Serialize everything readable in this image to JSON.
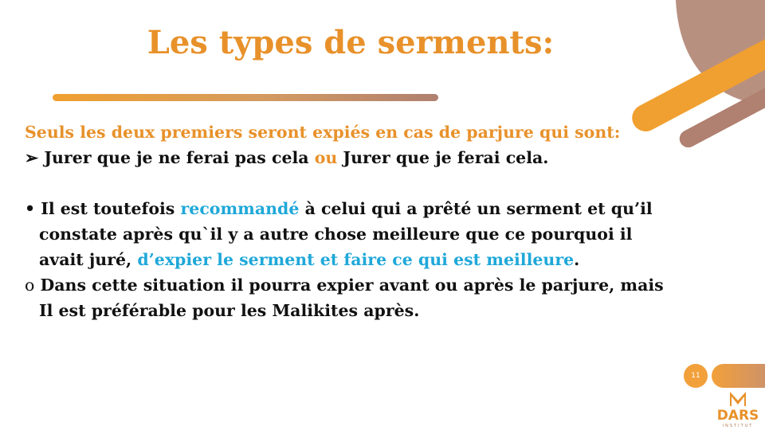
{
  "slide": {
    "title": "Les types de serments:",
    "intro": "Seuls les deux premiers seront expiés en cas de parjure qui sont:",
    "arrow_marker": "➢",
    "arrow_item": {
      "part1": " Jurer que je ne ferai pas cela ",
      "connector": "ou",
      "part2": " Jurer que je ferai cela."
    },
    "bullet_marker": "•",
    "bullet_item": {
      "part1": "Il est toutefois ",
      "highlight1": "recommandé",
      "part2": " à celui qui a prêté un serment et qu’il",
      "line2": "constate après qu`il y a autre chose meilleure que ce pourquoi il",
      "line3_start": "avait juré, ",
      "highlight2": "d’expier le serment et faire ce qui est meilleure",
      "line3_end": "."
    },
    "circle_marker": "o",
    "circle_item": {
      "line1": " Dans cette situation il pourra expier avant ou après le parjure, mais",
      "line2": "Il est préférable pour les Malikites après."
    },
    "page_number": "11"
  },
  "logo": {
    "name": "DARS",
    "tagline": "INSTITUT"
  },
  "colors": {
    "accent_orange": "#E8912A",
    "highlight_blue": "#1FA8D9",
    "decor_brown": "#B89080"
  }
}
